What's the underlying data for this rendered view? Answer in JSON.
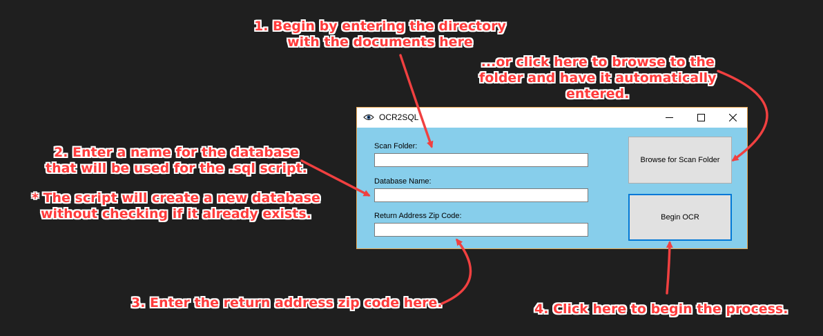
{
  "annotations": {
    "step1": [
      "1. Begin by entering the directory",
      "with the documents here"
    ],
    "browse_hint": [
      "...or click here to browse to the",
      "folder and have it automatically",
      "entered."
    ],
    "step2": [
      "2. Enter a name for the database",
      "that will be used for the .sql script."
    ],
    "step2_note": [
      "* The script will create a new database",
      "without checking if it already exists."
    ],
    "step3": "3. Enter the return address zip code here.",
    "step4": "4. Click here to begin the process."
  },
  "window": {
    "title": "OCR2SQL",
    "controls": {
      "minimize": "—",
      "maximize": "☐",
      "close": "✕"
    }
  },
  "form": {
    "scan_folder_label": "Scan Folder:",
    "scan_folder_value": "",
    "database_name_label": "Database Name:",
    "database_name_value": "",
    "zip_label": "Return Address Zip Code:",
    "zip_value": ""
  },
  "buttons": {
    "browse_label": "Browse for Scan Folder",
    "begin_label": "Begin OCR"
  },
  "colors": {
    "annotation_text": "#ff3b3b",
    "arrow": "#f04040",
    "window_body": "#87ceeb",
    "window_border": "#e8a44d",
    "focus_border": "#0078d7",
    "background": "#1f1f1f"
  },
  "icons": {
    "app": "eye-icon",
    "minimize": "minimize-icon",
    "maximize": "maximize-icon",
    "close": "close-icon"
  }
}
